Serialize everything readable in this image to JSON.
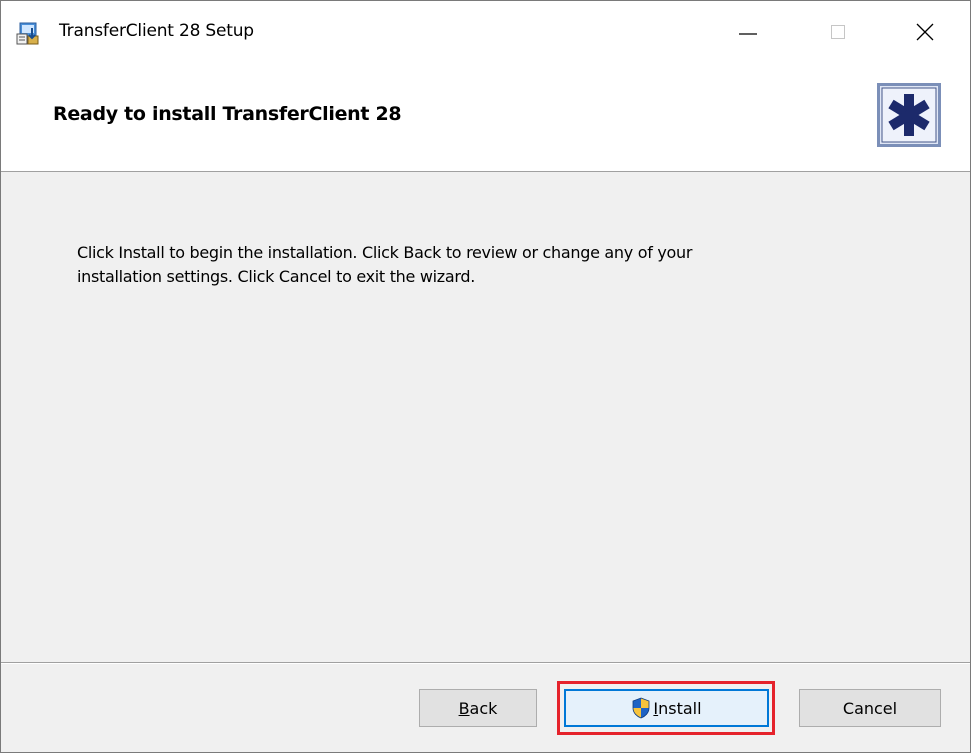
{
  "window": {
    "title": "TransferClient 28 Setup",
    "app_icon": "installer-package-icon",
    "controls": {
      "minimize_icon": "minimize-icon",
      "maximize_icon": "maximize-icon",
      "close_icon": "close-icon"
    }
  },
  "banner": {
    "title": "Ready to install TransferClient 28",
    "logo_icon": "asterisk-logo-icon"
  },
  "body": {
    "line1": "Click Install to begin the installation. Click Back to review or change any of your",
    "line2": "installation settings. Click Cancel to exit the wizard."
  },
  "buttons": {
    "back": {
      "mnemonic": "B",
      "rest": "ack"
    },
    "install": {
      "mnemonic": "I",
      "rest": "nstall",
      "icon": "uac-shield-icon"
    },
    "cancel": {
      "label": "Cancel"
    }
  },
  "colors": {
    "accent": "#0078d7",
    "highlight": "#e5222b",
    "dialog_bg": "#f0f0f0"
  }
}
